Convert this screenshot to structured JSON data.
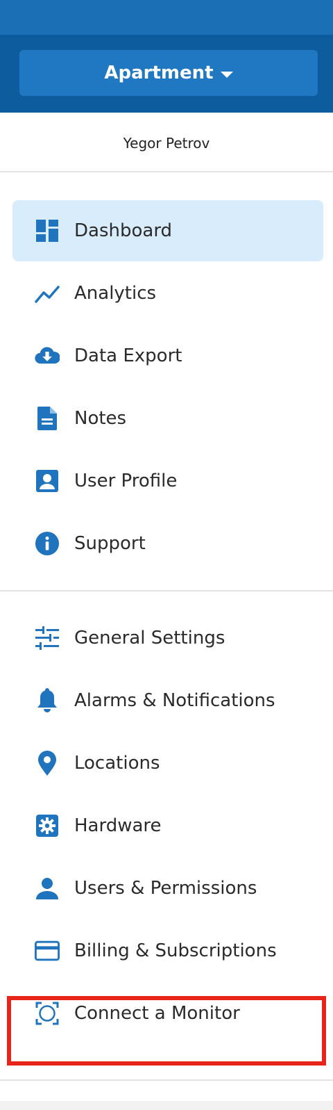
{
  "header": {
    "location_label": "Apartment"
  },
  "user": {
    "name": "Yegor Petrov"
  },
  "nav_primary": [
    {
      "label": "Dashboard",
      "icon": "dashboard-icon",
      "active": true
    },
    {
      "label": "Analytics",
      "icon": "trending-line-icon",
      "active": false
    },
    {
      "label": "Data Export",
      "icon": "cloud-download-icon",
      "active": false
    },
    {
      "label": "Notes",
      "icon": "document-icon",
      "active": false
    },
    {
      "label": "User Profile",
      "icon": "profile-card-icon",
      "active": false
    },
    {
      "label": "Support",
      "icon": "info-icon",
      "active": false
    }
  ],
  "nav_secondary": [
    {
      "label": "General Settings",
      "icon": "sliders-icon"
    },
    {
      "label": "Alarms & Notifications",
      "icon": "bell-icon"
    },
    {
      "label": "Locations",
      "icon": "map-pin-icon"
    },
    {
      "label": "Hardware",
      "icon": "gear-icon"
    },
    {
      "label": "Users & Permissions",
      "icon": "person-icon"
    },
    {
      "label": "Billing & Subscriptions",
      "icon": "credit-card-icon"
    },
    {
      "label": "Connect a Monitor",
      "icon": "monitor-scan-icon"
    }
  ],
  "colors": {
    "accent": "#1f74bd",
    "header_dark": "#0d5c9e",
    "header_top": "#1a6fb5",
    "active_bg": "#d9ecfb",
    "highlight": "#e8251b"
  }
}
